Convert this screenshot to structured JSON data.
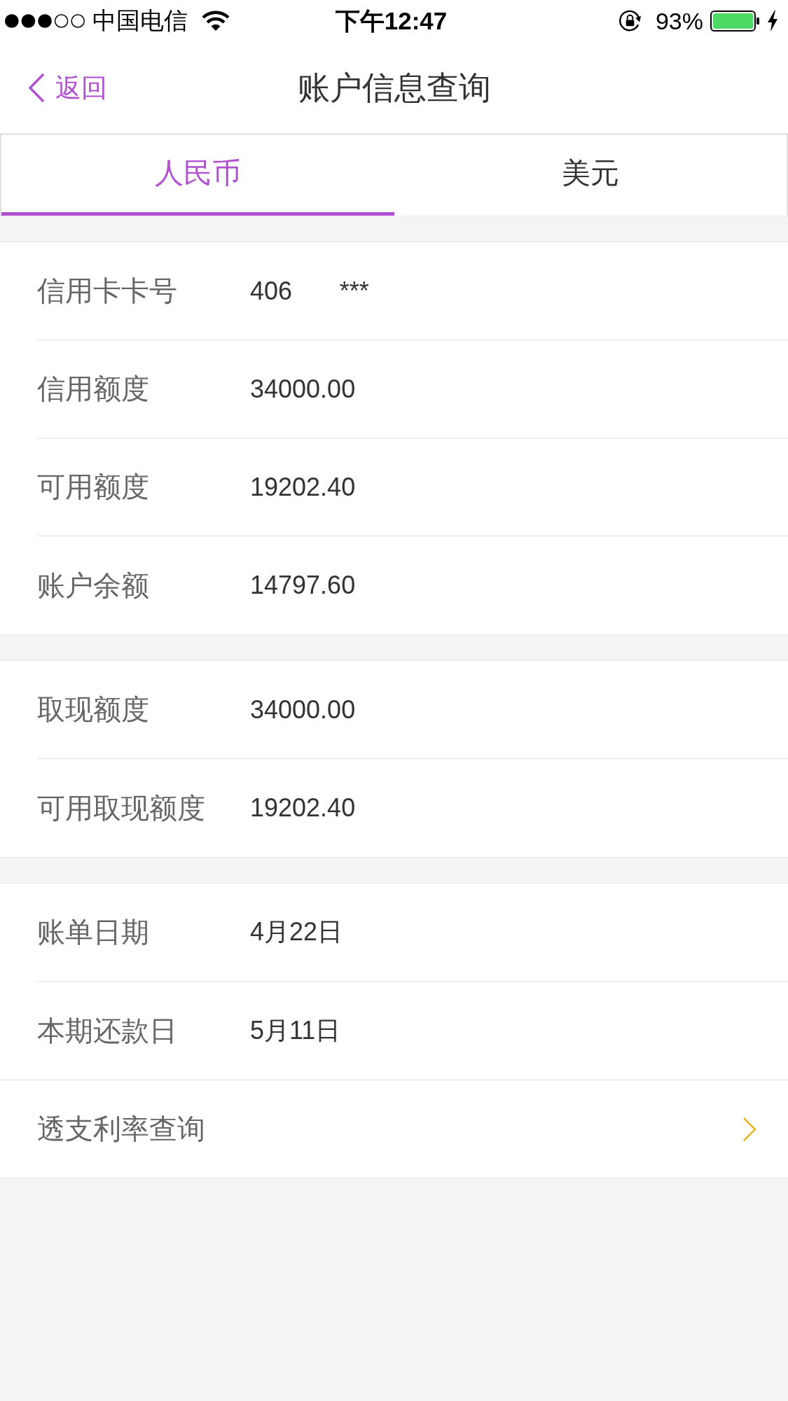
{
  "status_bar": {
    "carrier": "中国电信",
    "time": "下午12:47",
    "battery": "93%"
  },
  "nav": {
    "back": "返回",
    "title": "账户信息查询"
  },
  "tabs": [
    {
      "label": "人民币",
      "selected": true
    },
    {
      "label": "美元",
      "selected": false
    }
  ],
  "sections": [
    {
      "rows": [
        {
          "kind": "info",
          "label": "信用卡卡号",
          "value": "406 ***"
        },
        {
          "kind": "info",
          "label": "信用额度",
          "value": "34000.00"
        },
        {
          "kind": "info",
          "label": "可用额度",
          "value": "19202.40"
        },
        {
          "kind": "info",
          "label": "账户余额",
          "value": "14797.60"
        }
      ]
    },
    {
      "rows": [
        {
          "kind": "info",
          "label": "取现额度",
          "value": "34000.00"
        },
        {
          "kind": "info",
          "label": "可用取现额度",
          "value": "19202.40"
        }
      ]
    },
    {
      "rows": [
        {
          "kind": "info",
          "label": "账单日期",
          "value": "4月22日"
        },
        {
          "kind": "info",
          "label": "本期还款日",
          "value": "5月11日"
        },
        {
          "kind": "link",
          "label": "透支利率查询"
        }
      ]
    }
  ]
}
